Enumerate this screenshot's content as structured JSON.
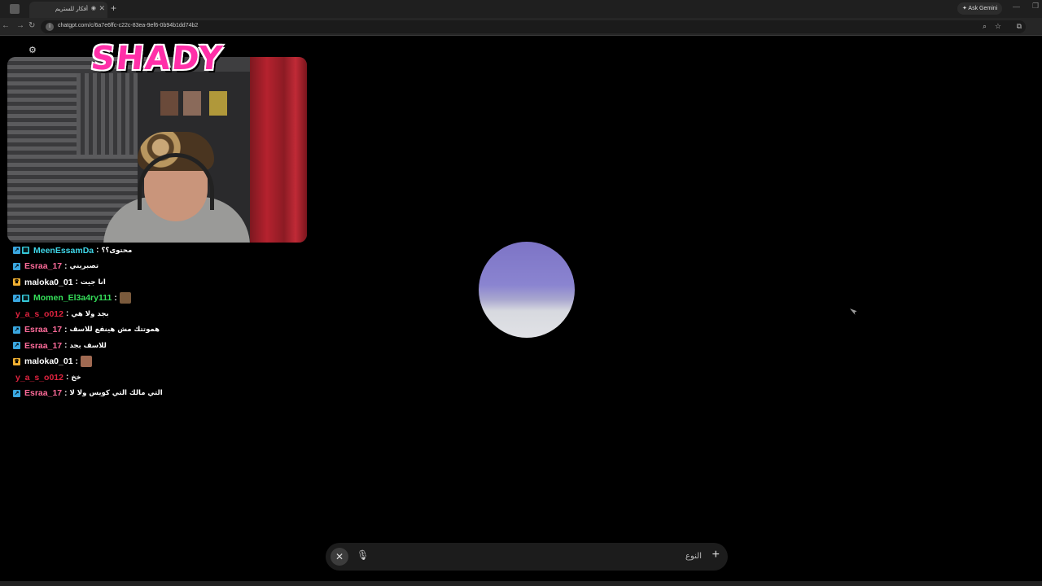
{
  "browser": {
    "tab_title": "أفكار للستريم",
    "tab_audio_icon": "speaker-icon",
    "new_tab": "+",
    "ask_gemini": "✦ Ask Gemini",
    "url": "chatgpt.com/c/6a7e6ffc-c22c-83ea-9ef6-0b94b1dd74b2"
  },
  "stream": {
    "logo_text": "SHADY",
    "chat": [
      {
        "badges": [
          "arrow",
          "grid"
        ],
        "user": "MeenEssamDa",
        "color": "#3fd6e8",
        "text": "محتوى؟؟"
      },
      {
        "badges": [
          "arrow"
        ],
        "user": "Esraa_17",
        "color": "#ff6b9a",
        "text": "تصبريني"
      },
      {
        "badges": [
          "crown"
        ],
        "user": "maloka0_01",
        "color": "#ffffff",
        "text": "انا جيت"
      },
      {
        "badges": [
          "arrow",
          "grid"
        ],
        "user": "Momen_El3a4ry111",
        "color": "#35e05a",
        "text": ""
      },
      {
        "badges": [],
        "user": "y_a_s_o012",
        "color": "#e0233f",
        "text": "بجد ولا هي"
      },
      {
        "badges": [
          "arrow"
        ],
        "user": "Esraa_17",
        "color": "#ff6b9a",
        "text": "هموتتك مش هينفع للاسف"
      },
      {
        "badges": [
          "arrow"
        ],
        "user": "Esraa_17",
        "color": "#ff6b9a",
        "text": "للاسف بجد"
      },
      {
        "badges": [
          "crown"
        ],
        "user": "maloka0_01",
        "color": "#ffffff",
        "text": ""
      },
      {
        "badges": [],
        "user": "y_a_s_o012",
        "color": "#e0233f",
        "text": "خخ"
      },
      {
        "badges": [
          "arrow"
        ],
        "user": "Esraa_17",
        "color": "#ff6b9a",
        "text": "التي مالك التي كويس ولا لا"
      }
    ]
  },
  "voice": {
    "type_label": "النوع"
  }
}
